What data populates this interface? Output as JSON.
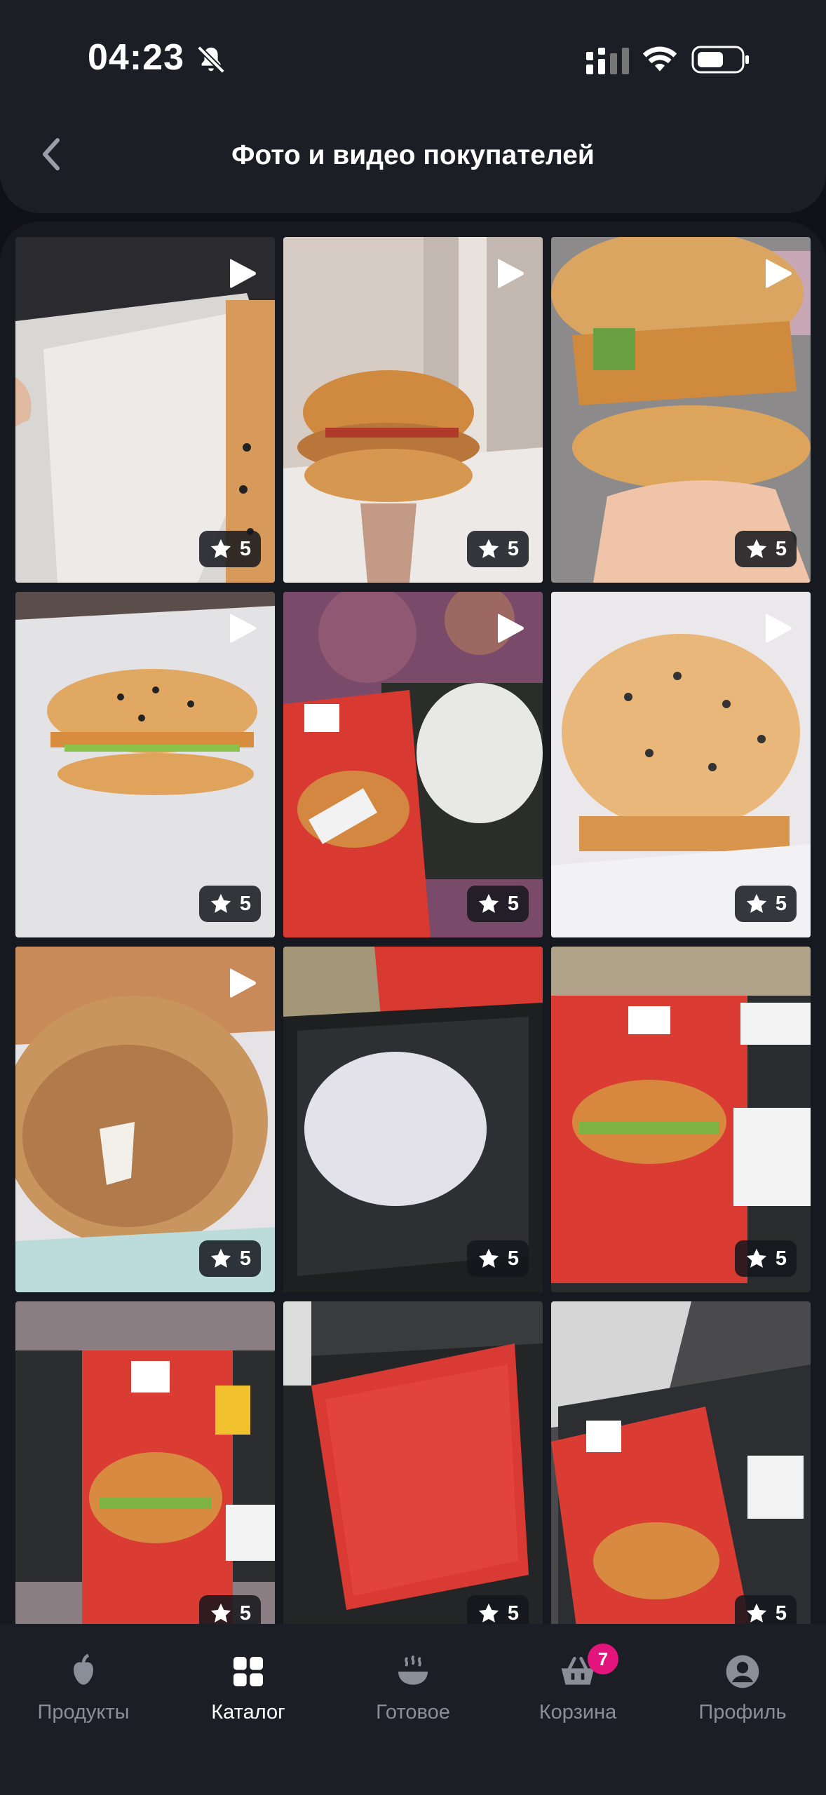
{
  "status_bar": {
    "time": "04:23",
    "icons": [
      "bell-off-icon",
      "signal-icon",
      "wifi-icon",
      "battery-icon"
    ]
  },
  "header": {
    "title": "Фото и видео покупателей",
    "back_icon": "chevron-left-icon"
  },
  "gallery": {
    "tiles": [
      {
        "rating": "5",
        "is_video": true,
        "subject": "wrapped burger in paper"
      },
      {
        "rating": "5",
        "is_video": true,
        "subject": "chicken burger held in hand"
      },
      {
        "rating": "5",
        "is_video": true,
        "subject": "bitten chicken burger close-up"
      },
      {
        "rating": "5",
        "is_video": true,
        "subject": "sesame bun burger on paper"
      },
      {
        "rating": "5",
        "is_video": true,
        "subject": "burger box on purple patterned table"
      },
      {
        "rating": "5",
        "is_video": true,
        "subject": "sesame bun burger close-up"
      },
      {
        "rating": "5",
        "is_video": true,
        "subject": "bitten burger bottom bun"
      },
      {
        "rating": "5",
        "is_video": false,
        "subject": "wrapped burger in black tray"
      },
      {
        "rating": "5",
        "is_video": false,
        "subject": "packaged burger with red label"
      },
      {
        "rating": "5",
        "is_video": false,
        "subject": "packaged burger with red label"
      },
      {
        "rating": "5",
        "is_video": false,
        "subject": "red label back side"
      },
      {
        "rating": "5",
        "is_video": false,
        "subject": "packaged burger with red label"
      }
    ],
    "rating_icon": "star-icon",
    "video_icon": "play-icon"
  },
  "bottom_nav": {
    "items": [
      {
        "label": "Продукты",
        "icon": "apple-icon",
        "active": false
      },
      {
        "label": "Каталог",
        "icon": "grid-icon",
        "active": true
      },
      {
        "label": "Готовое",
        "icon": "steaming-bowl-icon",
        "active": false
      },
      {
        "label": "Корзина",
        "icon": "basket-icon",
        "active": false,
        "badge": "7"
      },
      {
        "label": "Профиль",
        "icon": "profile-icon",
        "active": false
      }
    ]
  },
  "colors": {
    "background": "#0f1116",
    "surface": "#1b1e25",
    "badge": "#e3157c",
    "inactive": "#8a8e98"
  }
}
